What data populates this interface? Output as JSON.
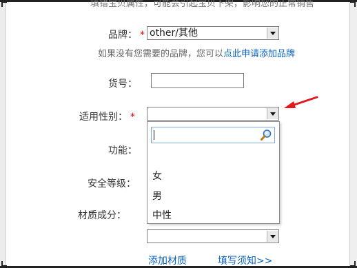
{
  "top_hint": "填错宝贝属性，可能会引起宝贝下架，影响您的正常销售",
  "brand": {
    "label": "品牌：",
    "required_mark": "*",
    "selected": "other/其他",
    "hint_prefix": "如果没有您需要的品牌，您可以",
    "hint_link": "点此申请添加品牌"
  },
  "sku": {
    "label": "货号：",
    "value": ""
  },
  "gender": {
    "label": "适用性别：",
    "required_mark": "*",
    "selected": "",
    "dropdown": {
      "search_value": "",
      "options": [
        "女",
        "男",
        "中性"
      ]
    }
  },
  "function": {
    "label": "功能："
  },
  "safety_level": {
    "label": "安全等级："
  },
  "material": {
    "label": "材质成分：",
    "selected": "",
    "add_link": "添加材质",
    "notice_link": "填写须知>>"
  },
  "colors": {
    "required": "#e60000",
    "link": "#0b63c0",
    "annotation_arrow": "#e01b1b"
  }
}
